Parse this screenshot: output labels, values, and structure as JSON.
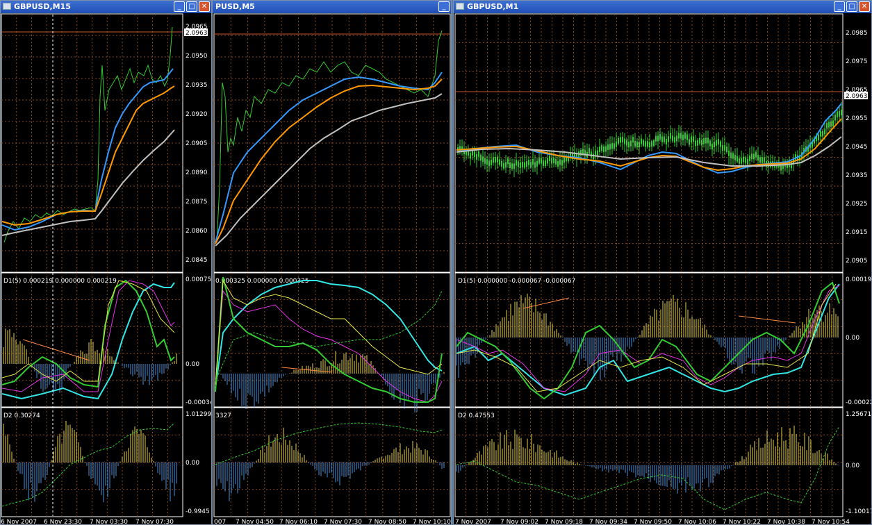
{
  "windows": [
    {
      "title": "GBPUSD,M15",
      "price_ticks": [
        "2.0965",
        "2.0950",
        "2.0935",
        "2.0920",
        "2.0905",
        "2.0890",
        "2.0875",
        "2.0860",
        "2.0845"
      ],
      "current_price": "2.0963",
      "ind1_label": "D1(5) 0.000219 0.000000 0.000219",
      "ind1_ticks": [
        "0.000751",
        "0.00",
        "-0.00034"
      ],
      "ind2_label": "D2 0.30274",
      "ind2_ticks": [
        "1.01299",
        "0.00",
        "-0.9945"
      ],
      "time_ticks": [
        "6 Nov 2007",
        "6 Nov 23:30",
        "7 Nov 03:30",
        "7 Nov 07:30"
      ]
    },
    {
      "title": "PUSD,M5",
      "price_ticks": [],
      "current_price": "",
      "ind1_label": "0.000325 0.000000 0.000325",
      "ind1_ticks": [],
      "ind2_label": "3327",
      "ind2_ticks": [],
      "time_ticks": [
        "007",
        "7 Nov 04:50",
        "7 Nov 06:10",
        "7 Nov 07:30",
        "7 Nov 08:50",
        "7 Nov 10:10"
      ]
    },
    {
      "title": "GBPUSD,M1",
      "price_ticks": [
        "2.0985",
        "2.0975",
        "2.0965",
        "2.0955",
        "2.0945",
        "2.0935",
        "2.0925",
        "2.0915",
        "2.0905"
      ],
      "current_price": "2.0963",
      "ind1_label": "D1(5) 0.000000 -0.000067 -0.000067",
      "ind1_ticks": [
        "0.00019",
        "0.00",
        "-0.00022"
      ],
      "ind2_label": "D2 0.47553",
      "ind2_ticks": [
        "1.25671",
        "0.00",
        "-1.10017"
      ],
      "time_ticks": [
        "7 Nov 2007",
        "7 Nov 09:02",
        "7 Nov 09:18",
        "7 Nov 09:34",
        "7 Nov 09:50",
        "7 Nov 10:06",
        "7 Nov 10:22",
        "7 Nov 10:38",
        "7 Nov 10:54"
      ]
    }
  ],
  "colors": {
    "candles": "#33cc33",
    "ma_fast": "#3399ff",
    "ma_mid": "#ff9900",
    "ma_slow": "#c0c0c0",
    "hist_up": "#e6d24a",
    "hist_down": "#4a90d9",
    "line_cyan": "#33e6e6",
    "line_magenta": "#e633e6",
    "line_yellow": "#e6e64d",
    "grid": "#8a4a1a"
  },
  "buttons": {
    "minimize": "_",
    "maximize": "□",
    "close": "✕"
  }
}
